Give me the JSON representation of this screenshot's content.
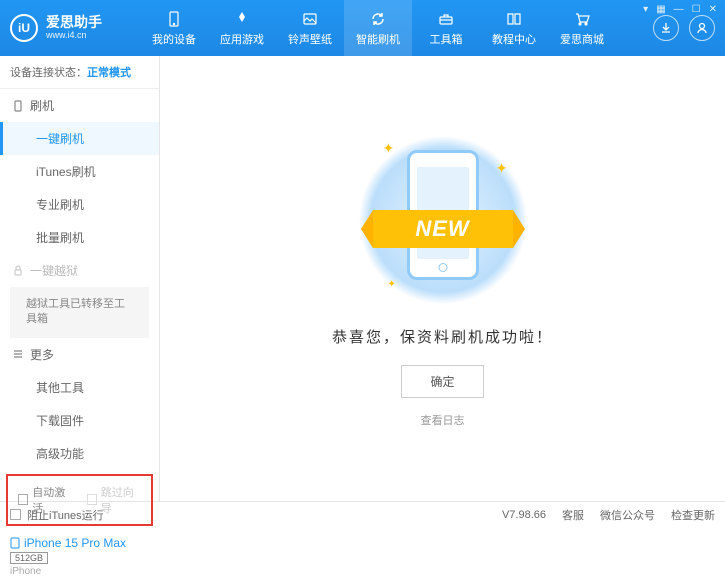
{
  "header": {
    "logo_letter": "iU",
    "logo_title": "爱思助手",
    "logo_sub": "www.i4.cn",
    "nav": [
      {
        "label": "我的设备"
      },
      {
        "label": "应用游戏"
      },
      {
        "label": "铃声壁纸"
      },
      {
        "label": "智能刷机"
      },
      {
        "label": "工具箱"
      },
      {
        "label": "教程中心"
      },
      {
        "label": "爱思商城"
      }
    ]
  },
  "sidebar": {
    "status_label": "设备连接状态：",
    "status_value": "正常模式",
    "flash_section": "刷机",
    "items": {
      "one_key": "一键刷机",
      "itunes": "iTunes刷机",
      "pro": "专业刷机",
      "batch": "批量刷机"
    },
    "jailbreak_section": "一键越狱",
    "jailbreak_note": "越狱工具已转移至工具箱",
    "more_section": "更多",
    "more_items": {
      "other_tools": "其他工具",
      "download_fw": "下载固件",
      "advanced": "高级功能"
    },
    "checkboxes": {
      "auto_activate": "自动激活",
      "skip_guide": "跳过向导"
    },
    "device": {
      "name": "iPhone 15 Pro Max",
      "storage": "512GB",
      "type": "iPhone"
    }
  },
  "main": {
    "ribbon": "NEW",
    "success_msg": "恭喜您，保资料刷机成功啦！",
    "confirm_btn": "确定",
    "view_log": "查看日志"
  },
  "footer": {
    "block_itunes": "阻止iTunes运行",
    "version": "V7.98.66",
    "service": "客服",
    "wechat": "微信公众号",
    "check_update": "检查更新"
  }
}
